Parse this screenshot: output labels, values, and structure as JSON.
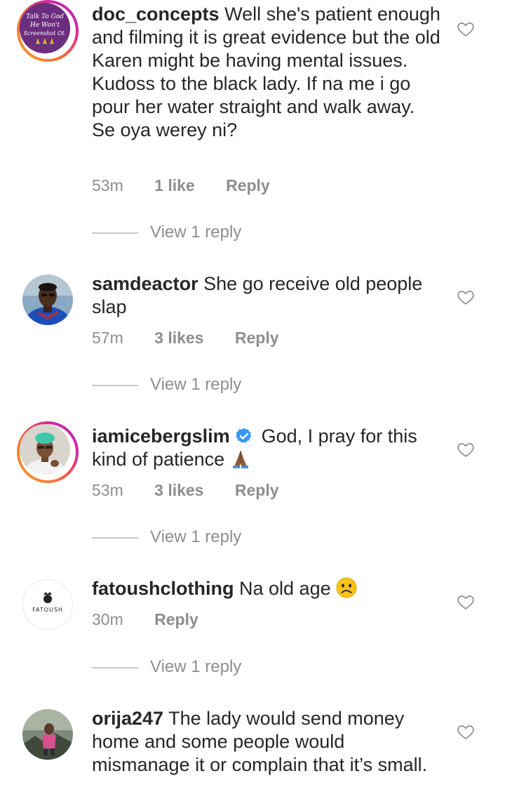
{
  "comments": [
    {
      "username": "doc_concepts",
      "text": "Well she's patient enough and filming it is great evidence but the old Karen might be having mental issues. Kudoss to the black lady. If na me i go pour her water straight  and walk away. Se oya werey ni?",
      "time": "53m",
      "likes": "1 like",
      "reply_label": "Reply",
      "view_replies": "View 1 reply",
      "avatar_text": [
        "Talk To God",
        "He Won't",
        "Screenshot Ot.",
        "🙏🙏🙏"
      ]
    },
    {
      "username": "samdeactor",
      "text": "She go receive old people slap",
      "time": "57m",
      "likes": "3 likes",
      "reply_label": "Reply",
      "view_replies": "View 1 reply"
    },
    {
      "username": "iamicebergslim",
      "text": "God, I pray for this kind of patience",
      "time": "53m",
      "likes": "3 likes",
      "reply_label": "Reply",
      "view_replies": "View 1 reply"
    },
    {
      "username": "fatoushclothing",
      "text": "Na old age",
      "time": "30m",
      "reply_label": "Reply",
      "view_replies": "View 1 reply",
      "avatar_text": "FATOUSH"
    },
    {
      "username": "orija247",
      "text": "The lady would send money home and some people would mismanage it or complain that it’s small."
    }
  ],
  "colors": {
    "text": "#262626",
    "secondary": "#8e8e8e",
    "verified": "#3897f0",
    "story_ring": "#d6249f"
  },
  "icons": [
    "heart-outline-icon",
    "verified-badge-icon",
    "folded-hands-emoji",
    "frowning-face-emoji"
  ]
}
